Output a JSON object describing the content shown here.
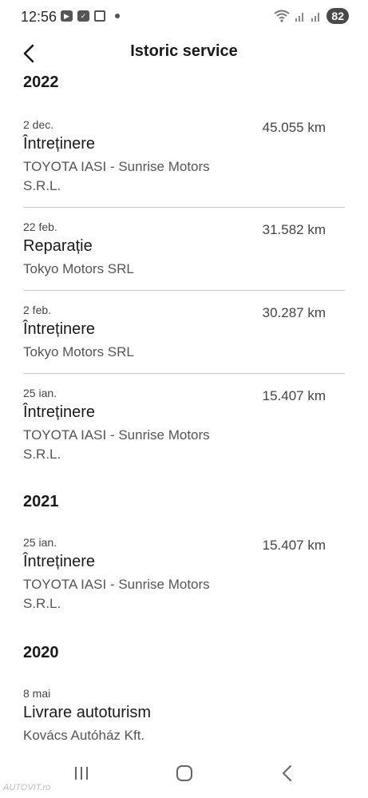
{
  "status_bar": {
    "time": "12:56",
    "battery": "82"
  },
  "header": {
    "title": "Istoric service"
  },
  "years": [
    {
      "year": "2022",
      "entries": [
        {
          "date": "2 dec.",
          "type": "Întreținere",
          "provider": "TOYOTA IASI - Sunrise Motors S.R.L.",
          "km": "45.055 km"
        },
        {
          "date": "22 feb.",
          "type": "Reparație",
          "provider": "Tokyo Motors SRL",
          "km": "31.582 km"
        },
        {
          "date": "2 feb.",
          "type": "Întreținere",
          "provider": "Tokyo Motors SRL",
          "km": "30.287 km"
        },
        {
          "date": "25 ian.",
          "type": "Întreținere",
          "provider": "TOYOTA IASI - Sunrise Motors S.R.L.",
          "km": "15.407 km"
        }
      ]
    },
    {
      "year": "2021",
      "entries": [
        {
          "date": "25 ian.",
          "type": "Întreținere",
          "provider": "TOYOTA IASI - Sunrise Motors S.R.L.",
          "km": "15.407 km"
        }
      ]
    },
    {
      "year": "2020",
      "entries": [
        {
          "date": "8 mai",
          "type": "Livrare autoturism",
          "provider": "Kovács Autóház Kft.",
          "km": ""
        }
      ]
    }
  ],
  "watermark": "AUTOVIT.ro",
  "icons": {
    "back": "chevron-left-icon",
    "nav_recents": "recents-icon",
    "nav_home": "home-icon",
    "nav_back": "nav-back-icon"
  }
}
